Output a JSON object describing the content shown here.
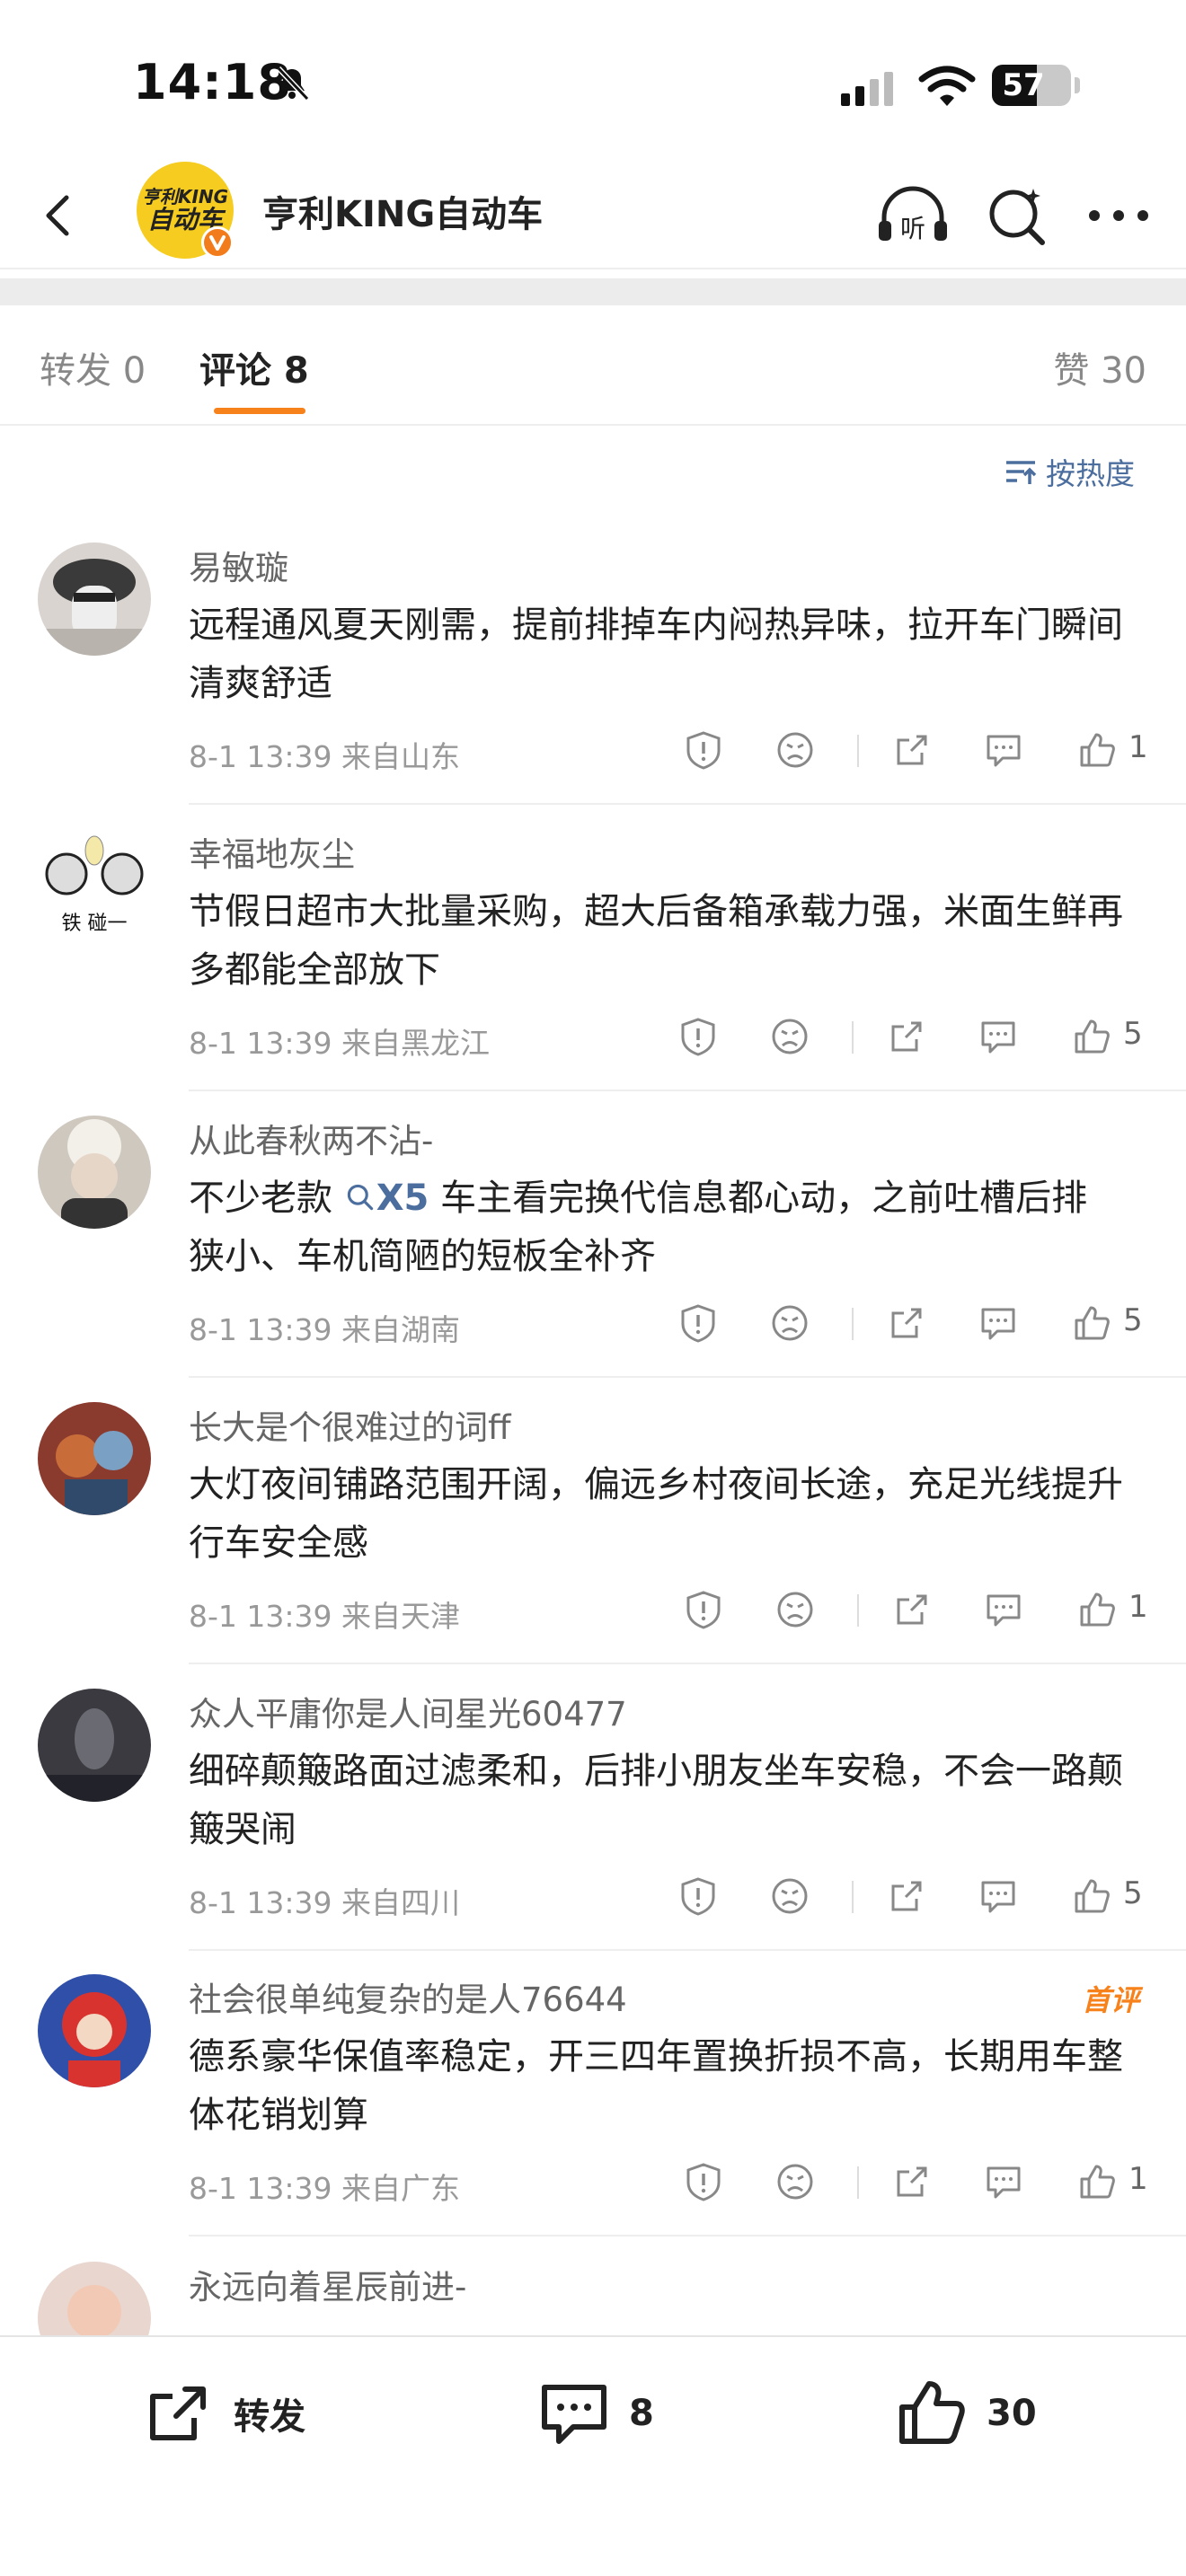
{
  "status_bar": {
    "time": "14:18",
    "battery": "57",
    "battery_level": 0.57
  },
  "header": {
    "title": "亨利KING自动车",
    "avatar_line1": "亨利KING",
    "avatar_line2": "自动车"
  },
  "tabs": {
    "forward": "转发 0",
    "comment": "评论 8",
    "like": "赞 30"
  },
  "sort": {
    "label": "按热度"
  },
  "comments": [
    {
      "name": "易敏璇",
      "text": "远程通风夏天刚需，提前排掉车内闷热异味，拉开车门瞬间清爽舒适",
      "meta": "8-1 13:39  来自山东",
      "likes": "1"
    },
    {
      "name": "幸福地灰尘",
      "text": "节假日超市大批量采购，超大后备箱承载力强，米面生鲜再多都能全部放下",
      "meta": "8-1 13:39  来自黑龙江",
      "likes": "5"
    },
    {
      "name": "从此春秋两不沾-",
      "text_before": "不少老款 ",
      "tag": "X5",
      "text_after": " 车主看完换代信息都心动，之前吐槽后排狭小、车机简陋的短板全补齐",
      "meta": "8-1 13:39  来自湖南",
      "likes": "5"
    },
    {
      "name": "长大是个很难过的词ff",
      "text": "大灯夜间铺路范围开阔，偏远乡村夜间长途，充足光线提升行车安全感",
      "meta": "8-1 13:39  来自天津",
      "likes": "1"
    },
    {
      "name": "众人平庸你是人间星光60477",
      "text": "细碎颠簸路面过滤柔和，后排小朋友坐车安稳，不会一路颠簸哭闹",
      "meta": "8-1 13:39  来自四川",
      "likes": "5"
    },
    {
      "name": "社会很单纯复杂的是人76644",
      "badge": "首评",
      "text": "德系豪华保值率稳定，开三四年置换折损不高，长期用车整体花销划算",
      "meta": "8-1 13:39  来自广东",
      "likes": "1"
    },
    {
      "name": "永远向着星辰前进-"
    }
  ],
  "bottom_bar": {
    "forward": "转发",
    "comment_count": "8",
    "like_count": "30"
  }
}
